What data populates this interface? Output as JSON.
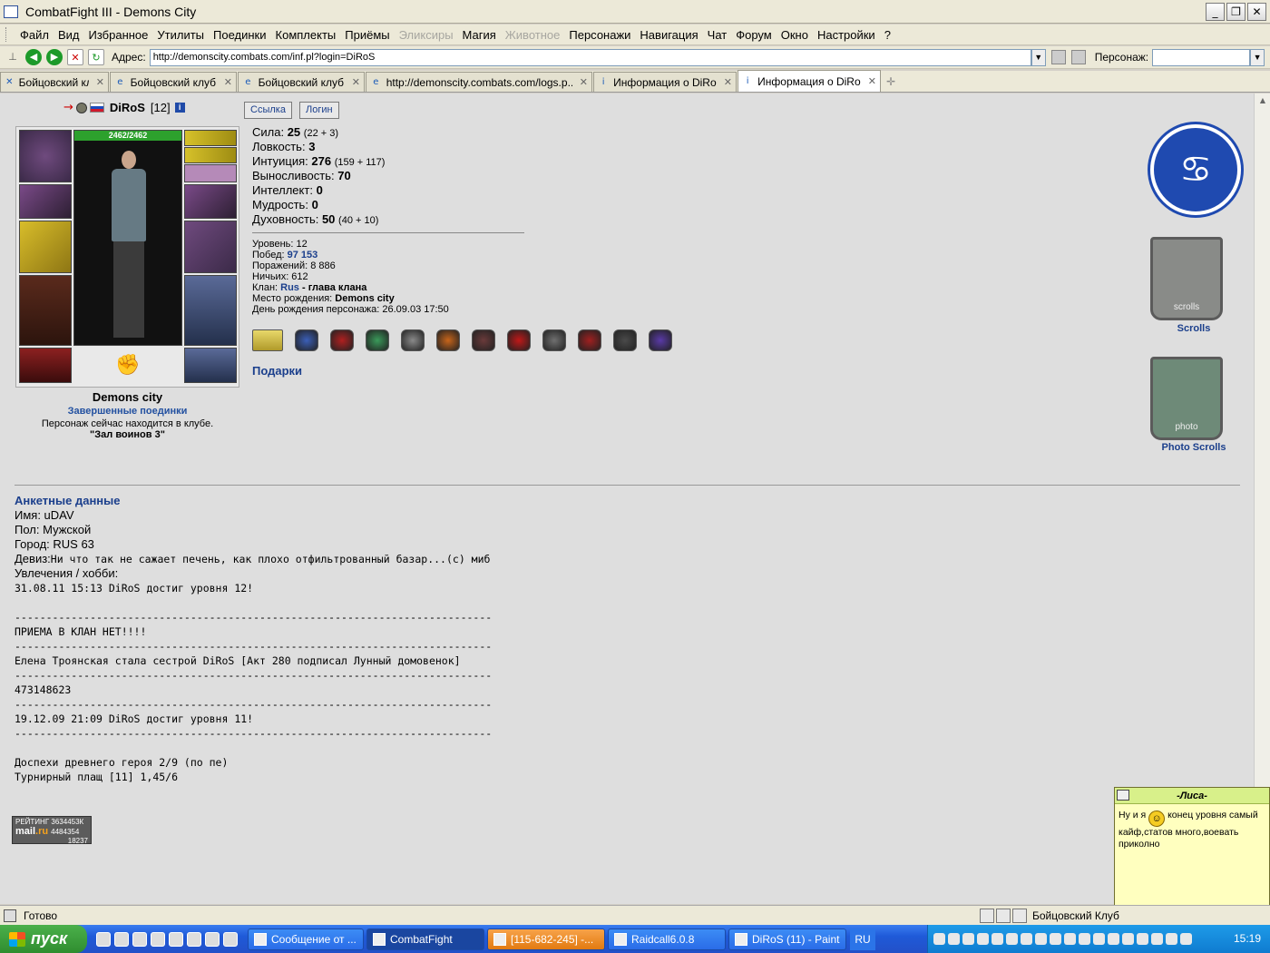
{
  "window": {
    "title": "CombatFight III - Demons City"
  },
  "menu": [
    "Файл",
    "Вид",
    "Избранное",
    "Утилиты",
    "Поединки",
    "Комплекты",
    "Приёмы",
    "Эликсиры",
    "Магия",
    "Животное",
    "Персонажи",
    "Навигация",
    "Чат",
    "Форум",
    "Окно",
    "Настройки",
    "?"
  ],
  "menu_disabled": [
    "Эликсиры",
    "Животное"
  ],
  "address": {
    "label": "Адрес:",
    "url": "http://demonscity.combats.com/inf.pl?login=DiRoS",
    "persona_label": "Персонаж:"
  },
  "tabs": [
    {
      "label": "Бойцовский клуб",
      "icon": "crossed-swords-icon",
      "active": false
    },
    {
      "label": "Бойцовский клуб.",
      "icon": "ie-icon",
      "active": false
    },
    {
      "label": "Бойцовский клуб.",
      "icon": "ie-icon",
      "active": false
    },
    {
      "label": "http://demonscity.combats.com/logs.p...",
      "icon": "ie-icon",
      "active": false
    },
    {
      "label": "Информация о DiRoS",
      "icon": "info-icon",
      "active": false
    },
    {
      "label": "Информация о DiRoS",
      "icon": "info-icon",
      "active": true
    }
  ],
  "character": {
    "nick": "DiRoS",
    "level": "[12]",
    "hp": "2462/2462",
    "city": "Demons city",
    "finished_link": "Завершенные поединки",
    "location_text": "Персонаж сейчас находится в клубе.",
    "room": "\"Зал воинов 3\""
  },
  "buttons": {
    "link": "Ссылка",
    "login": "Логин"
  },
  "stats": [
    {
      "label": "Сила:",
      "value": "25",
      "extra": "(22 + 3)"
    },
    {
      "label": "Ловкость:",
      "value": "3",
      "extra": ""
    },
    {
      "label": "Интуиция:",
      "value": "276",
      "extra": "(159 + 117)"
    },
    {
      "label": "Выносливость:",
      "value": "70",
      "extra": ""
    },
    {
      "label": "Интеллект:",
      "value": "0",
      "extra": ""
    },
    {
      "label": "Мудрость:",
      "value": "0",
      "extra": ""
    },
    {
      "label": "Духовность:",
      "value": "50",
      "extra": "(40 + 10)"
    }
  ],
  "info": {
    "level": "Уровень: 12",
    "wins_label": "Побед:",
    "wins": "97 153",
    "losses": "Поражений: 8 886",
    "draws": "Ничьих: 612",
    "clan_label": "Клан:",
    "clan": "Rus",
    "clan_role": "- глава клана",
    "birthplace_label": "Место рождения:",
    "birthplace": "Demons city",
    "birthday": "День рождения персонажа: 26.09.03 17:50"
  },
  "badges": [
    {
      "name": "ring-icon",
      "color": "#d8c24a"
    },
    {
      "name": "shield-blue-icon",
      "color": "#3b5fb8"
    },
    {
      "name": "shield-red-icon",
      "color": "#b02020"
    },
    {
      "name": "shield-green-icon",
      "color": "#3a9a5a"
    },
    {
      "name": "shield-grey-icon",
      "color": "#8a8a8a"
    },
    {
      "name": "shield-orange-icon",
      "color": "#c8651a"
    },
    {
      "name": "shield-dark-icon",
      "color": "#6a3a3a"
    },
    {
      "name": "red-sun-icon",
      "color": "#c01818"
    },
    {
      "name": "wolf-icon",
      "color": "#707070"
    },
    {
      "name": "red-orb-icon",
      "color": "#a02020"
    },
    {
      "name": "cross-icon",
      "color": "#4a4a4a"
    },
    {
      "name": "purple-star-icon",
      "color": "#5a3aa8"
    }
  ],
  "gifts_label": "Подарки",
  "right_panel": {
    "scrolls": "Scrolls",
    "photo_scrolls": "Photo Scrolls",
    "scrolls_banner": "scrolls",
    "photo_banner": "photo"
  },
  "anketa": {
    "title": "Анкетные данные",
    "name": "Имя: uDAV",
    "gender": "Пол: Мужской",
    "city": "Город: RUS 63",
    "motto_label": "Девиз:",
    "motto": "Ни что так не сажает печень, как плохо отфильтрованный базар...(с) миб",
    "hobby_label": "Увлечения / хобби:"
  },
  "hobby_lines": [
    "31.08.11 15:13 DiRoS достиг уровня 12!",
    "",
    "----------------------------------------------------------------------------",
    "ПРИЕМА В КЛАН НЕТ!!!!",
    "----------------------------------------------------------------------------",
    "Елена Троянская стала сестрой DiRoS [Акт 280 подписал Лунный домовенок]",
    "----------------------------------------------------------------------------",
    "473148623",
    "----------------------------------------------------------------------------",
    "19.12.09 21:09 DiRoS достиг уровня 11!",
    "----------------------------------------------------------------------------",
    "",
    "Доспехи древнего героя 2/9 (по пе)",
    "Турнирный плащ [11] 1,45/6"
  ],
  "rating": {
    "line1": "РЕЙТИНГ 3634453К",
    "mail": "mail",
    "ru": ".ru",
    "n1": "4484354",
    "n2": "18237"
  },
  "popup": {
    "title": "-Лиса-",
    "text_before": "Ну и я",
    "text_after": "конец уровня самый кайф,статов много,воевать приколно"
  },
  "status": {
    "text": "Готово",
    "right": "Бойцовский Клуб"
  },
  "taskbar": {
    "start": "пуск",
    "tasks": [
      {
        "label": "Сообщение от ...",
        "style": "normal"
      },
      {
        "label": "CombatFight",
        "style": "active"
      },
      {
        "label": "[115-682-245] -...",
        "style": "orange"
      },
      {
        "label": "Raidcall6.0.8",
        "style": "normal"
      },
      {
        "label": "DiRoS (11) - Paint",
        "style": "normal"
      }
    ],
    "lang": "RU",
    "clock": "15:19"
  }
}
